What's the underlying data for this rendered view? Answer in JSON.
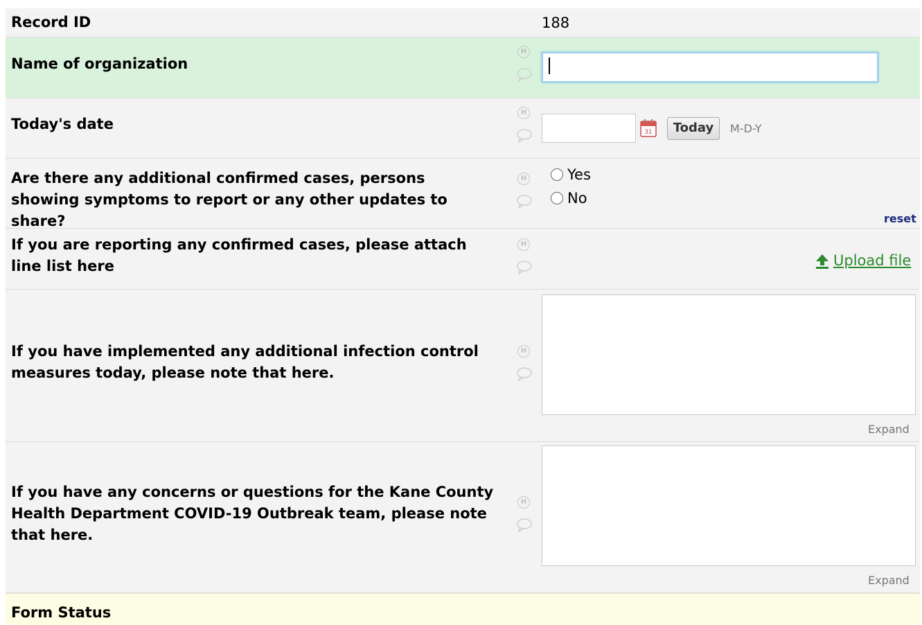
{
  "record": {
    "label": "Record ID",
    "value": "188"
  },
  "fields": {
    "org_name": {
      "label": "Name of organization",
      "value": ""
    },
    "todays_date": {
      "label": "Today's date",
      "value": "",
      "today_button": "Today",
      "format": "M-D-Y"
    },
    "additional_cases": {
      "label": "Are there any additional confirmed cases, persons showing symptoms to report or any other updates to share?",
      "options": [
        "Yes",
        "No"
      ],
      "reset": "reset"
    },
    "line_list": {
      "label": "If you are reporting any confirmed cases, please attach line list here",
      "upload": "Upload file"
    },
    "infection_control": {
      "label": "If you have implemented any additional infection control measures today, please note that here.",
      "value": "",
      "expand": "Expand"
    },
    "concerns": {
      "label": "If you have any concerns or questions for the Kane County Health Department COVID-19 Outbreak team, please note that here.",
      "value": "",
      "expand": "Expand"
    }
  },
  "form_status": {
    "label": "Form Status"
  },
  "icons": {
    "history": "history-icon",
    "comment": "comment-icon",
    "calendar": "calendar-icon",
    "upload": "upload-arrow-icon"
  },
  "colors": {
    "highlight_row": "#d9f2dc",
    "status_row": "#fdfde3",
    "reset_link": "#1a2b7c",
    "upload_link": "#2b8a2b"
  }
}
